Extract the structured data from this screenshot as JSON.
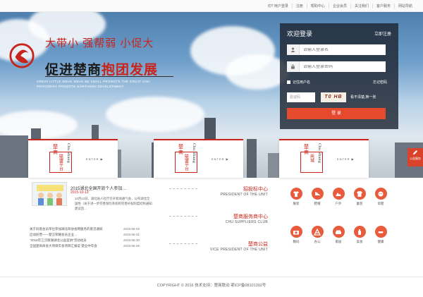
{
  "topnav": [
    "切? 用户登录",
    "注册",
    "帮助中心",
    "企业会员",
    "关注我们",
    "客户服务",
    "网站导航"
  ],
  "slogan": {
    "line1": "大带小   强帮弱   小促大",
    "line2_pre": "促进楚商",
    "line2_hl": "抱团发展",
    "english": "GREAT LITTLE WEAK WEAK BE SMALL PROMOTE THE GREAT CHU PROVIDERS PROMOTE NORTHERN DEVELOPMENT"
  },
  "login": {
    "title": "欢迎登录",
    "register": "立即注册",
    "username_placeholder": "请输入登录名",
    "password_placeholder": "请输入登录密码",
    "remember": "记住用户名",
    "forgot": "忘记密码",
    "captcha_placeholder": "验证码",
    "captcha_text": "T0 HB",
    "captcha_refresh": "看不清楚,换一张",
    "submit": "登 录"
  },
  "cards": [
    {
      "cn": "楚商",
      "en": "Chu Shang",
      "label": "联盟平台",
      "enter": "ENTER ▶"
    },
    {
      "cn": "楚商",
      "en": "Chu Shang",
      "label": "联盟平台",
      "enter": "ENTER ▶"
    },
    {
      "cn": "楚商",
      "en": "Chu Shang",
      "label": "商城",
      "enter": "ENTER ▶"
    }
  ],
  "sidetab": "公益服务",
  "news": {
    "title": "2015湖北全国开放个人参加…",
    "date": "2015-10-13",
    "excerpt": "10月13日，湖北省人社厅召开新闻通气会，公布湖北全国性（关于进一步完善保险系统和完善补贴制度结构通知建议后…",
    "list": [
      {
        "t": "关于同意会员单位参加湖北商协会网服务的意见通知",
        "d": "2016-06-03"
      },
      {
        "t": "启动民营——楚汉荣耀会员企业…",
        "d": "2016-05-31"
      },
      {
        "t": "\"2016年江汉联湖湖北公益宣讲\"活动动员",
        "d": "2016-05-30"
      },
      {
        "t": "全国楚商商会大项目年会项目汇报说 楚业中年会",
        "d": "2016-05-26"
      }
    ]
  },
  "mid_links": [
    {
      "cn": "招投标中心",
      "en": "PRESIDENT OF THE UNIT"
    },
    {
      "cn": "楚商服务商中心",
      "en": "CHU SUPPLIERS CLUB"
    },
    {
      "cn": "楚商公益",
      "en": "VICE PRESIDENT OF THE UNIT"
    }
  ],
  "icons": [
    {
      "icon": "shirt-icon",
      "label": "服装"
    },
    {
      "icon": "shoe-icon",
      "label": "鞋帽"
    },
    {
      "icon": "mountain-icon",
      "label": "户外"
    },
    {
      "icon": "tshirt-icon",
      "label": "童装"
    },
    {
      "icon": "face-icon",
      "label": "母婴"
    },
    {
      "icon": "camera-icon",
      "label": "数码"
    },
    {
      "icon": "chart-icon",
      "label": "办公"
    },
    {
      "icon": "sofa-icon",
      "label": "家居"
    },
    {
      "icon": "bottle-icon",
      "label": "美妆"
    },
    {
      "icon": "pill-icon",
      "label": "健康"
    }
  ],
  "colors": {
    "accent": "#c9241b",
    "button": "#e64a2e",
    "icon_bg": "#e85b3c"
  },
  "footer": "COPYRIGHT © 2016 技术支持：楚商联动 鄂ICP备08101392号"
}
